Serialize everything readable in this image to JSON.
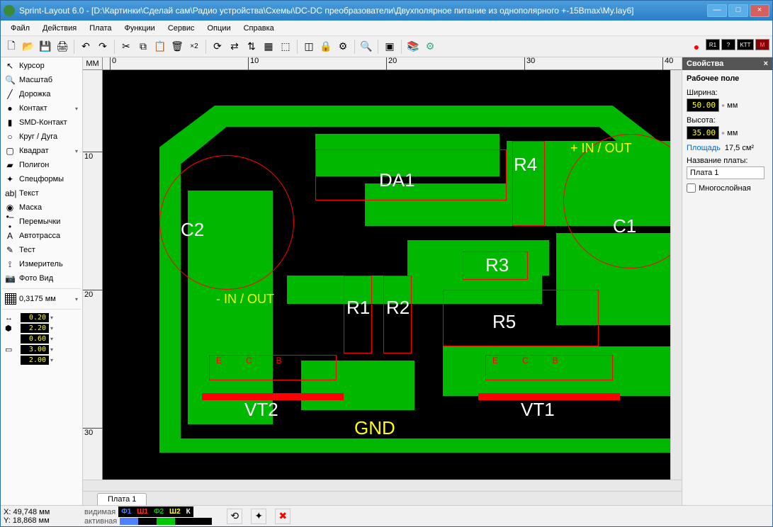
{
  "window": {
    "title": "Sprint-Layout 6.0 - [D:\\Картинки\\Сделай сам\\Радио устройства\\Схемы\\DC-DC преобразователи\\Двухполярное питание из однополярного +-15Bmax\\My.lay6]"
  },
  "menu": [
    "Файл",
    "Действия",
    "Плата",
    "Функции",
    "Сервис",
    "Опции",
    "Справка"
  ],
  "tools": [
    {
      "icon": "↖",
      "label": "Курсор"
    },
    {
      "icon": "🔍",
      "label": "Масштаб"
    },
    {
      "icon": "╱",
      "label": "Дорожка"
    },
    {
      "icon": "●",
      "label": "Контакт",
      "dd": true
    },
    {
      "icon": "▮",
      "label": "SMD-Контакт"
    },
    {
      "icon": "○",
      "label": "Круг / Дуга"
    },
    {
      "icon": "▢",
      "label": "Квадрат",
      "dd": true
    },
    {
      "icon": "▰",
      "label": "Полигон"
    },
    {
      "icon": "✦",
      "label": "Спецформы"
    },
    {
      "icon": "ab|",
      "label": "Текст"
    },
    {
      "icon": "◉",
      "label": "Маска"
    },
    {
      "icon": "•–•",
      "label": "Перемычки"
    },
    {
      "icon": "A",
      "label": "Автотрасса"
    },
    {
      "icon": "✎",
      "label": "Тест"
    },
    {
      "icon": "⟟",
      "label": "Измеритель"
    },
    {
      "icon": "📷",
      "label": "Фото Вид"
    }
  ],
  "grid": "0,3175 мм",
  "params": [
    {
      "icon": "↔",
      "val": "0.20"
    },
    {
      "icon": "⬢",
      "val": "2.20"
    },
    {
      "icon": "",
      "val": "0.60"
    },
    {
      "icon": "▭",
      "val": "3.00"
    },
    {
      "icon": "",
      "val": "2.00"
    }
  ],
  "ruler": {
    "unit": "MM",
    "xticks": [
      0,
      10,
      20,
      30,
      40
    ],
    "yticks": [
      10,
      20,
      30
    ]
  },
  "pcblabels": {
    "white": [
      "C2",
      "DA1",
      "R4",
      "C1",
      "R1",
      "R2",
      "R3",
      "R5",
      "VT2",
      "VT1"
    ],
    "yellow": [
      "+ IN / OUT",
      "- IN / OUT",
      "GND"
    ],
    "redsmall": [
      "E",
      "C",
      "B",
      "E",
      "C",
      "B"
    ]
  },
  "tabs": [
    "Плата 1"
  ],
  "props": {
    "header": "Свойства",
    "title": "Рабочее поле",
    "width_label": "Ширина:",
    "width": "50.00",
    "unit": "мм",
    "height_label": "Высота:",
    "height": "35.00",
    "area_label": "Площадь",
    "area": "17,5 см²",
    "name_label": "Название платы:",
    "name": "Плата 1",
    "multilayer": "Многослойная"
  },
  "status": {
    "x": "X:   49,748 мм",
    "y": "Y:   18,868 мм",
    "visible": "видимая",
    "active": "активная",
    "layers": [
      {
        "t": "Ф1",
        "c": "#5080ff"
      },
      {
        "t": "Ш1",
        "c": "#ff3030"
      },
      {
        "t": "Ф2",
        "c": "#00c800"
      },
      {
        "t": "Ш2",
        "c": "#ffff00"
      },
      {
        "t": "К",
        "c": "#ffffff"
      }
    ]
  }
}
